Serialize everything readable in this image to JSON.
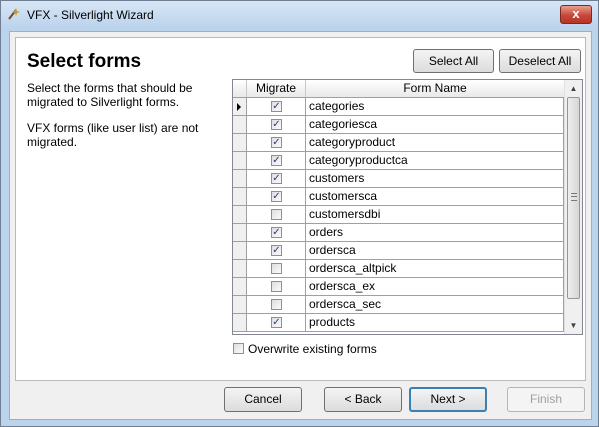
{
  "window": {
    "title": "VFX - Silverlight Wizard",
    "close_glyph": "x"
  },
  "page": {
    "heading": "Select forms",
    "description1": "Select the forms that should be migrated to Silverlight forms.",
    "description2": "VFX forms (like user list) are not migrated."
  },
  "actions": {
    "select_all": "Select All",
    "deselect_all": "Deselect All"
  },
  "grid": {
    "columns": [
      "Migrate",
      "Form Name"
    ],
    "rows": [
      {
        "name": "categories",
        "migrate": true,
        "current": true
      },
      {
        "name": "categoriesca",
        "migrate": true
      },
      {
        "name": "categoryproduct",
        "migrate": true
      },
      {
        "name": "categoryproductca",
        "migrate": true
      },
      {
        "name": "customers",
        "migrate": true
      },
      {
        "name": "customersca",
        "migrate": true
      },
      {
        "name": "customersdbi",
        "migrate": false
      },
      {
        "name": "orders",
        "migrate": true
      },
      {
        "name": "ordersca",
        "migrate": true
      },
      {
        "name": "ordersca_altpick",
        "migrate": false
      },
      {
        "name": "ordersca_ex",
        "migrate": false
      },
      {
        "name": "ordersca_sec",
        "migrate": false
      },
      {
        "name": "products",
        "migrate": true
      }
    ]
  },
  "overwrite": {
    "label": "Overwrite existing forms",
    "checked": false
  },
  "footer": {
    "cancel": "Cancel",
    "back": "< Back",
    "next": "Next >",
    "finish": "Finish"
  },
  "icons": {
    "app": "wizard-wand-icon",
    "check": "checkmark-icon",
    "row_indicator": "triangle-right-icon",
    "scroll_up": "scroll-up-icon",
    "scroll_down": "scroll-down-icon"
  }
}
